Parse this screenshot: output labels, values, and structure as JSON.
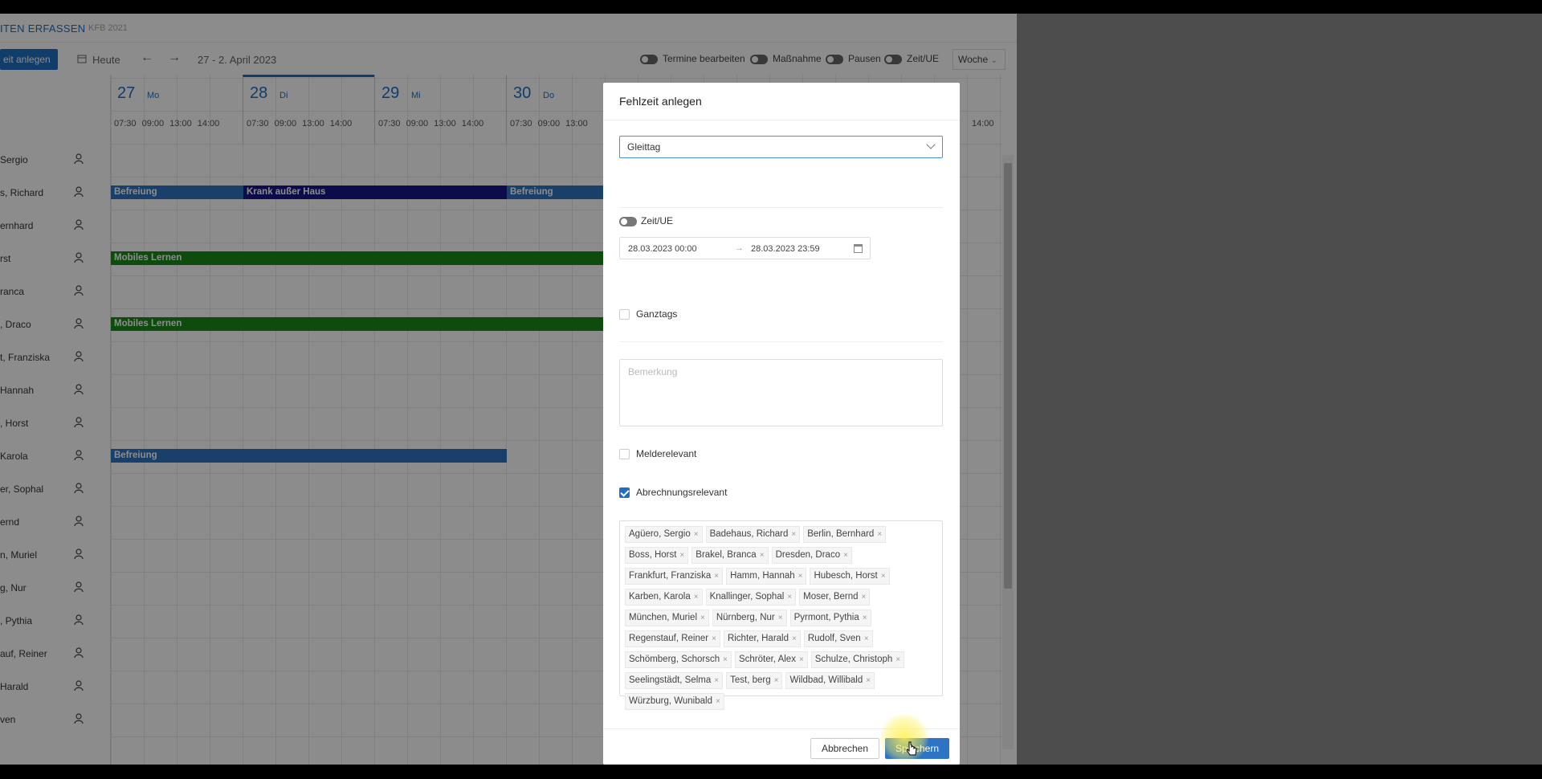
{
  "app": {
    "title": "ITEN ERFASSEN",
    "subtitle": "KFB 2021"
  },
  "toolbar": {
    "create_label": "eit anlegen",
    "today_label": "Heute",
    "date_range": "27 - 2. April 2023",
    "toggles": [
      "Termine bearbeiten",
      "Maßnahme",
      "Pausen",
      "Zeit/UE"
    ],
    "view_select": "Woche"
  },
  "calendar": {
    "days": [
      {
        "num": "27",
        "weekday": "Mo",
        "times": "07:30 09:00 13:00 14:00"
      },
      {
        "num": "28",
        "weekday": "Di",
        "times": "07:30 09:00 13:00 14:00"
      },
      {
        "num": "29",
        "weekday": "Mi",
        "times": "07:30 09:00 13:00 14:00"
      },
      {
        "num": "30",
        "weekday": "Do",
        "times": "07:30 09:00 13:00"
      }
    ],
    "trailing_time": "14:00",
    "people": [
      "Sergio",
      "s, Richard",
      "ernhard",
      "rst",
      "ranca",
      ", Draco",
      "t, Franziska",
      "Hannah",
      ", Horst",
      "Karola",
      "er, Sophal",
      "ernd",
      "n, Muriel",
      "g, Nur",
      ", Pythia",
      "auf, Reiner",
      "Harald",
      "ven"
    ],
    "events": {
      "befreiung": "Befreiung",
      "krank": "Krank außer Haus",
      "mobiles": "Mobiles Lernen"
    }
  },
  "modal": {
    "title": "Fehlzeit anlegen",
    "type_select": "Gleittag",
    "toggle_label": "Zeit/UE",
    "date_start": "28.03.2023 00:00",
    "date_arrow": "→",
    "date_end": "28.03.2023 23:59",
    "ganztags_label": "Ganztags",
    "remark_placeholder": "Bemerkung",
    "melderelevant_label": "Melderelevant",
    "abrechnung_label": "Abrechnungsrelevant",
    "abrechnung_checked": true,
    "tags": [
      "Agüero, Sergio",
      "Badehaus, Richard",
      "Berlin, Bernhard",
      "Boss, Horst",
      "Brakel, Branca",
      "Dresden, Draco",
      "Frankfurt, Franziska",
      "Hamm, Hannah",
      "Hubesch, Horst",
      "Karben, Karola",
      "Knallinger, Sophal",
      "Moser, Bernd",
      "München, Muriel",
      "Nürnberg, Nur",
      "Pyrmont, Pythia",
      "Regenstauf, Reiner",
      "Richter, Harald",
      "Rudolf, Sven",
      "Schömberg, Schorsch",
      "Schröter, Alex",
      "Schulze, Christoph",
      "Seelingstädt, Selma",
      "Test, berg",
      "Wildbad, Willibald",
      "Würzburg, Wunibald"
    ],
    "cancel_label": "Abbrechen",
    "save_label": "Speichern"
  },
  "colors": {
    "accent": "#1f6fc4",
    "event_blue": "#2e73c4",
    "event_dark": "#16158a",
    "event_green": "#1a8a1a"
  }
}
